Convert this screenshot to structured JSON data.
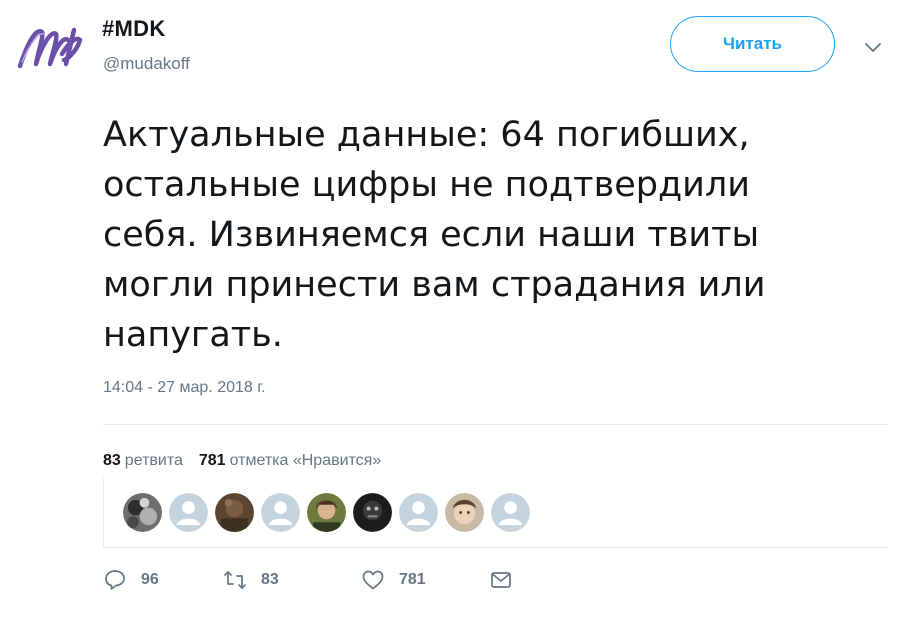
{
  "header": {
    "name": "#MDK",
    "handle": "@mudakoff",
    "logo_text": "Mdk",
    "follow_label": "Читать"
  },
  "tweet": {
    "lines": [
      "Актуальные данные: 64 погибших,",
      "остальные цифры не подтвердили",
      "себя. Извиняемся если наши твиты",
      "могли принести вам страдания или",
      "напугать."
    ],
    "timestamp": "14:04 - 27 мар. 2018 г."
  },
  "stats": {
    "retweets_count": "83",
    "retweets_label": "ретвита",
    "likes_count": "781",
    "likes_label": "отметка «Нравится»"
  },
  "likers": [
    "photo",
    "default",
    "photo",
    "default",
    "photo",
    "photo",
    "default",
    "photo",
    "default"
  ],
  "actions": {
    "reply_count": "96",
    "retweet_count": "83",
    "like_count": "781"
  },
  "colors": {
    "accent": "#1da1f2",
    "secondary_text": "#657786",
    "primary_text": "#14171a",
    "logo": "#6b4fa8"
  }
}
